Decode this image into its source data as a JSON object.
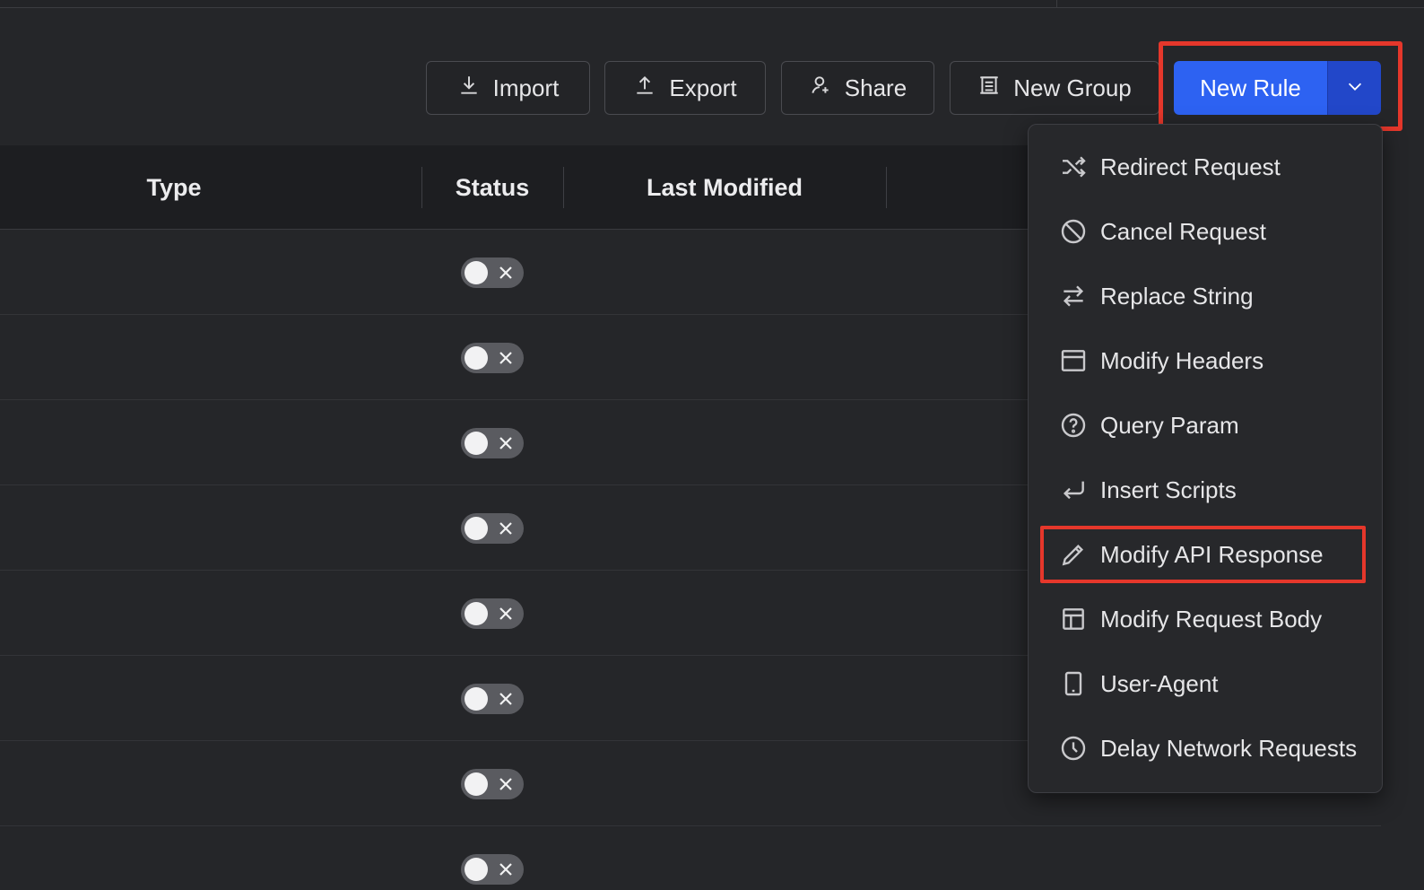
{
  "toolbar": {
    "import_label": "Import",
    "export_label": "Export",
    "share_label": "Share",
    "new_group_label": "New Group",
    "new_rule_label": "New Rule"
  },
  "table": {
    "columns": [
      "Type",
      "Status",
      "Last Modified"
    ],
    "rows": [
      {
        "status": "disabled"
      },
      {
        "status": "disabled"
      },
      {
        "status": "disabled"
      },
      {
        "status": "disabled"
      },
      {
        "status": "disabled"
      },
      {
        "status": "disabled"
      },
      {
        "status": "disabled"
      },
      {
        "status": "disabled"
      }
    ]
  },
  "new_rule_menu": {
    "items": [
      {
        "label": "Redirect Request",
        "icon": "shuffle-icon"
      },
      {
        "label": "Cancel Request",
        "icon": "block-icon"
      },
      {
        "label": "Replace String",
        "icon": "swap-arrows-icon"
      },
      {
        "label": "Modify Headers",
        "icon": "window-icon"
      },
      {
        "label": "Query Param",
        "icon": "question-circle-icon"
      },
      {
        "label": "Insert Scripts",
        "icon": "enter-arrow-icon"
      },
      {
        "label": "Modify API Response",
        "icon": "pencil-icon"
      },
      {
        "label": "Modify Request Body",
        "icon": "layout-icon"
      },
      {
        "label": "User-Agent",
        "icon": "tablet-icon"
      },
      {
        "label": "Delay Network Requests",
        "icon": "clock-icon"
      }
    ],
    "highlighted_item": "Modify API Response"
  },
  "colors": {
    "primary": "#2d62f2",
    "primary_dark": "#2247c9",
    "highlight": "#e5372b",
    "background": "#252629"
  }
}
